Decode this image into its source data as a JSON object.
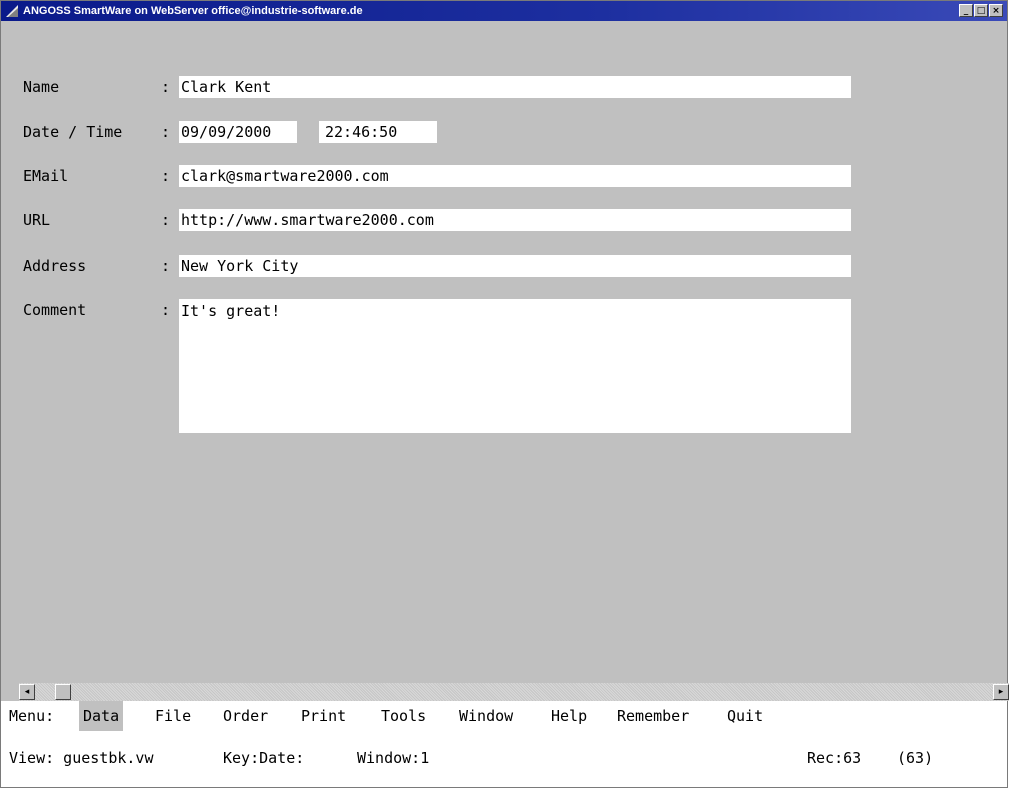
{
  "window": {
    "title": "ANGOSS SmartWare on WebServer office@industrie-software.de",
    "buttons": [
      "_",
      "□",
      "×"
    ]
  },
  "form": {
    "colon": ":",
    "fields": [
      {
        "label": "Name",
        "value": "Clark Kent"
      },
      {
        "label": "Date / Time",
        "date": "09/09/2000",
        "time": "22:46:50"
      },
      {
        "label": "EMail",
        "value": "clark@smartware2000.com"
      },
      {
        "label": "URL",
        "value": "http://www.smartware2000.com"
      },
      {
        "label": "Address",
        "value": "New York City"
      },
      {
        "label": "Comment",
        "value": "It's great!"
      }
    ]
  },
  "scrollbar": {
    "left_arrow": "◂",
    "right_arrow": "▸"
  },
  "menu": {
    "prefix": "Menu:",
    "items": [
      "Data",
      "File",
      "Order",
      "Print",
      "Tools",
      "Window",
      "Help",
      "Remember",
      "Quit"
    ],
    "active": "Data"
  },
  "status": {
    "view": "View: guestbk.vw",
    "key": "Key:Date:",
    "window": "Window:1",
    "rec": "Rec:63",
    "total": "(63)"
  },
  "colors": {
    "titlebar": "#0a1a8a",
    "form_bg": "#c0c0c0",
    "field_bg": "#ffffff"
  }
}
